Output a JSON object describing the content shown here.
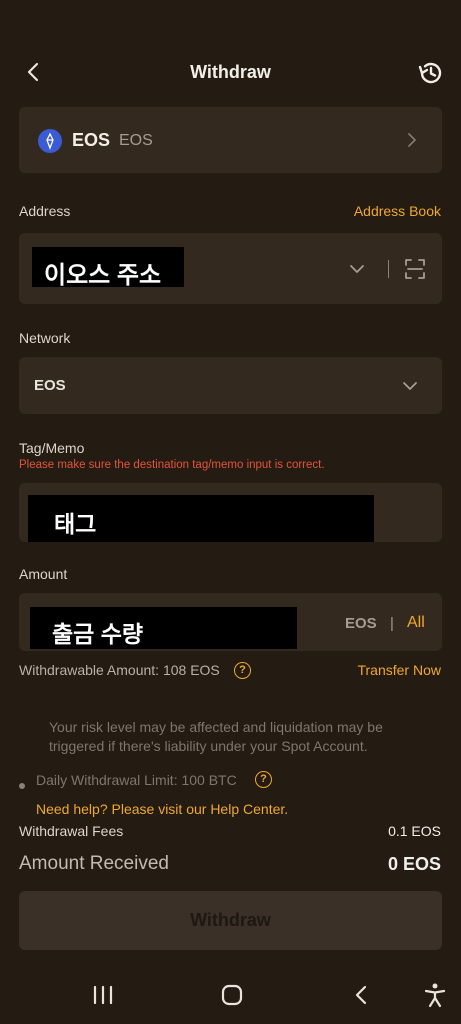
{
  "header": {
    "title": "Withdraw",
    "back_icon": "chevron-left-icon",
    "history_icon": "history-icon"
  },
  "coin": {
    "symbol": "EOS",
    "name": "EOS",
    "logo_color": "#3b5bd6"
  },
  "address": {
    "label": "Address",
    "address_book_label": "Address Book",
    "value": "이오스 주소"
  },
  "network": {
    "label": "Network",
    "value": "EOS"
  },
  "tag_memo": {
    "label": "Tag/Memo",
    "warning": "Please make sure the destination tag/memo input is correct.",
    "value": "태그"
  },
  "amount": {
    "label": "Amount",
    "value": "출금 수량",
    "unit": "EOS",
    "separator": "|",
    "all_label": "All",
    "withdrawable_label": "Withdrawable Amount: 108 EOS",
    "transfer_now_label": "Transfer Now"
  },
  "notes": {
    "risk_text": "Your risk level may be affected and liquidation may be triggered if there's liability under your Spot Account.",
    "daily_limit": "Daily Withdrawal Limit: 100 BTC",
    "help_center": "Need help? Please visit our Help Center."
  },
  "fees": {
    "label": "Withdrawal Fees",
    "value": "0.1 EOS"
  },
  "received": {
    "label": "Amount Received",
    "value": "0 EOS"
  },
  "withdraw_button": "Withdraw",
  "colors": {
    "accent": "#f0a82d",
    "background": "#241b13",
    "card": "#33291f",
    "warning": "#e2553a"
  }
}
